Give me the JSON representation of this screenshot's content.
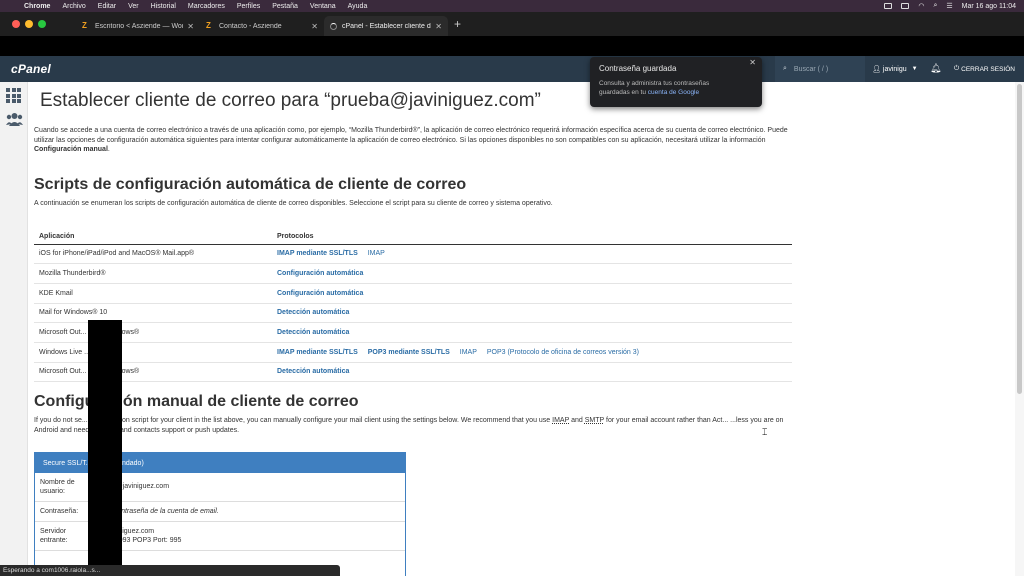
{
  "macbar": {
    "app": "Chrome",
    "menus": [
      "Archivo",
      "Editar",
      "Ver",
      "Historial",
      "Marcadores",
      "Perfiles",
      "Pestaña",
      "Ventana",
      "Ayuda"
    ],
    "datetime": "Mar 16 ago  11:04"
  },
  "tabs": [
    {
      "title": "Escritorio < Asziende — WordP...",
      "icon": "wordpress-icon"
    },
    {
      "title": "Contacto - Asziende",
      "icon": "wordpress-icon"
    },
    {
      "title": "cPanel - Establecer cliente de c...",
      "icon": "loading-spinner-icon"
    }
  ],
  "new_tab": "+",
  "cpanel": {
    "logo": "cPanel",
    "search_placeholder": "Buscar ( / )",
    "user": "javinigu",
    "logout": "CERRAR SESIÓN"
  },
  "password_popup": {
    "title": "Contraseña guardada",
    "text": "Consulta y administra tus contraseñas guardadas en tu",
    "link": "cuenta de Google"
  },
  "page": {
    "title": "Establecer cliente de correo para “prueba@javiniguez.com”",
    "intro_1": "Cuando se accede a una cuenta de correo electrónico a través de una aplicación como, por ejemplo, “Mozilla Thunderbird®”, la aplicación de correo electrónico requerirá información específica acerca de su cuenta de correo electrónico. Puede utilizar las opciones de configuración automática siguientes para intentar configurar automáticamente la aplicación de correo electrónico. Si las opciones disponibles no son compatibles con su aplicación, necesitará utilizar la información",
    "intro_bold": "Configuración manual",
    "intro_end": ".",
    "auto_heading": "Scripts de configuración automática de cliente de correo",
    "auto_sub": "A continuación se enumeran los scripts de configuración automática de cliente de correo disponibles. Seleccione el script para su cliente de correo y sistema operativo.",
    "table_headers": [
      "Aplicación",
      "Protocolos"
    ],
    "rows": [
      {
        "app": "iOS for iPhone/iPad/iPod and MacOS® Mail.app®",
        "protocols": [
          {
            "label": "IMAP mediante SSL/TLS",
            "bold": true
          },
          {
            "label": "IMAP",
            "bold": false
          }
        ]
      },
      {
        "app": "Mozilla Thunderbird®",
        "protocols": [
          {
            "label": "Configuración automática",
            "bold": true
          }
        ]
      },
      {
        "app": "KDE Kmail",
        "protocols": [
          {
            "label": "Configuración automática",
            "bold": true
          }
        ]
      },
      {
        "app": "Mail for Windows® 10",
        "protocols": [
          {
            "label": "Detección automática",
            "bold": true
          }
        ]
      },
      {
        "app": "Microsoft Out... ® for Windows®",
        "protocols": [
          {
            "label": "Detección automática",
            "bold": true
          }
        ]
      },
      {
        "app": "Windows Live ...",
        "protocols": [
          {
            "label": "IMAP mediante SSL/TLS",
            "bold": true
          },
          {
            "label": "POP3 mediante SSL/TLS",
            "bold": true
          },
          {
            "label": "IMAP",
            "bold": false
          },
          {
            "label": "POP3 (Protocolo de oficina de correos versión 3)",
            "bold": false
          }
        ]
      },
      {
        "app": "Microsoft Out... ® for Windows®",
        "protocols": [
          {
            "label": "Detección automática",
            "bold": true
          }
        ]
      }
    ],
    "manual_heading": "Configuración manual de cliente de correo",
    "manual_text_1": "If you do not se... configuration script for your client in the list above, you can manually configure your mail client using the settings below. We recommend that you use",
    "manual_imap": "IMAP",
    "manual_and": "and",
    "manual_smtp": "SMTP",
    "manual_text_2": "for your email account rather than Act... ...less you are on Android and need calendar and contacts support or push updates.",
    "panel_title": "Secure SSL/T... (Recomendado)",
    "panel_rows": [
      {
        "label": "Nombre de usuario:",
        "value": "...ba@javiniguez.com",
        "italic": false
      },
      {
        "label": "Contraseña:",
        "value": "...a contraseña de la cuenta de email.",
        "italic": true
      },
      {
        "label": "Servidor entrante:",
        "value": "...javiniguez.com",
        "value2": "Port: 993   POP3 Port: 995",
        "italic": false
      }
    ]
  },
  "status": "Esperando a com1006.raiola...s..."
}
